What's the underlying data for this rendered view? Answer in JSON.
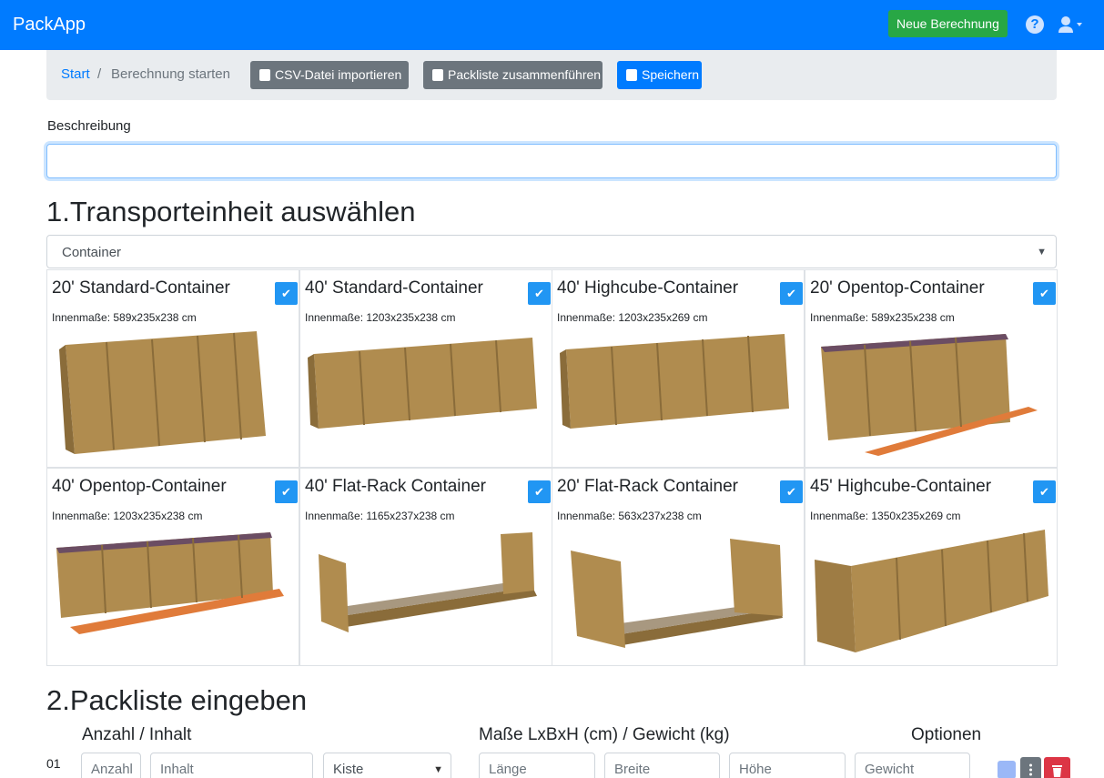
{
  "app": {
    "brand": "PackApp",
    "new_calc_label": "Neue Berechnung"
  },
  "breadcrumb": {
    "start": "Start",
    "separator": "/",
    "current": "Berechnung starten"
  },
  "toolbar": {
    "csv_label": "CSV-Datei importieren",
    "merge_label": "Packliste zusammenführen",
    "save_label": "Speichern"
  },
  "description": {
    "label": "Beschreibung",
    "value": ""
  },
  "section1": {
    "title": "1.Transporteinheit auswählen",
    "unit_type": "Container"
  },
  "containers": [
    {
      "title": "20' Standard-Container",
      "dims": "Innenmaße: 589x235x238 cm",
      "checked": "✔"
    },
    {
      "title": "40' Standard-Container",
      "dims": "Innenmaße: 1203x235x238 cm",
      "checked": "✔"
    },
    {
      "title": "40' Highcube-Container",
      "dims": "Innenmaße: 1203x235x269 cm",
      "checked": "✔"
    },
    {
      "title": "20' Opentop-Container",
      "dims": "Innenmaße: 589x235x238 cm",
      "checked": "✔"
    },
    {
      "title": "40' Opentop-Container",
      "dims": "Innenmaße: 1203x235x238 cm",
      "checked": "✔"
    },
    {
      "title": "40' Flat-Rack Container",
      "dims": "Innenmaße: 1165x237x238 cm",
      "checked": "✔"
    },
    {
      "title": "20' Flat-Rack Container",
      "dims": "Innenmaße: 563x237x238 cm",
      "checked": "✔"
    },
    {
      "title": "45' Highcube-Container",
      "dims": "Innenmaße: 1350x235x269 cm",
      "checked": "✔"
    }
  ],
  "section2": {
    "title": "2.Packliste eingeben",
    "col_qty": "Anzahl / Inhalt",
    "col_dims": "Maße LxBxH (cm) / Gewicht (kg)",
    "col_opts": "Optionen"
  },
  "row": {
    "num": "01",
    "qty_placeholder": "Anzahl",
    "content_placeholder": "Inhalt",
    "package_type": "Kiste",
    "length_placeholder": "Länge",
    "width_placeholder": "Breite",
    "height_placeholder": "Höhe",
    "weight_placeholder": "Gewicht"
  },
  "colors": {
    "primary": "#007bff",
    "success": "#28a745",
    "secondary": "#6c757d",
    "danger": "#dc3545",
    "container": "#b08c4f",
    "platform": "#e07b3a"
  }
}
